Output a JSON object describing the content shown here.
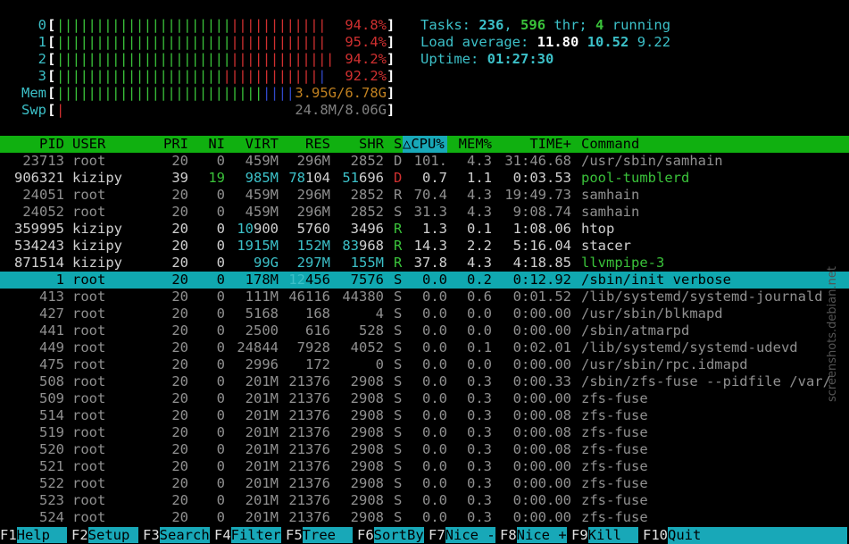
{
  "colors": {
    "green": "#3ac23a",
    "red": "#d03030",
    "blue": "#3048c8",
    "orange": "#c08020",
    "gray": "#808080",
    "cyan": "#3cc0c8",
    "teal": "#18a8b8",
    "white": "#ffffff",
    "dim": "#909090"
  },
  "cpus": [
    {
      "label": "0",
      "green": "||||||||||||||||||||||",
      "red": "||||||||||||",
      "blue": "",
      "pct": "94.8%"
    },
    {
      "label": "1",
      "green": "||||||||||||||||||||||",
      "red": "||||||||||||",
      "blue": "",
      "pct": "95.4%"
    },
    {
      "label": "2",
      "green": "||||||||||||||||||||||",
      "red": "|||||||||||||",
      "blue": "",
      "pct": "94.2%"
    },
    {
      "label": "3",
      "green": "|||||||||||||||||||||",
      "red": "||||||||||||",
      "blue": "|",
      "pct": "92.2%"
    }
  ],
  "mem": {
    "label": "Mem",
    "green": "||||||||||||||||||||||||||",
    "blue": "||||",
    "value": "3.95G/6.78G"
  },
  "swp": {
    "label": "Swp",
    "red": "|",
    "value": "24.8M/8.06G"
  },
  "summary": {
    "tasks_label": "Tasks:",
    "tasks": "236",
    "sep": ",",
    "threads": "596",
    "thr_label": "thr;",
    "running": "4",
    "running_label": "running",
    "load_label": "Load average:",
    "load1": "11.80",
    "load5": "10.52",
    "load15": "9.22",
    "uptime_label": "Uptime:",
    "uptime": "01:27:30"
  },
  "header": {
    "pid": "PID",
    "user": "USER",
    "pri": "PRI",
    "ni": "NI",
    "virt": "VIRT",
    "res": "RES",
    "shr": "SHR",
    "s": "S",
    "cpu": "△CPU%",
    "mem": "MEM%",
    "time": "TIME+",
    "cmd": "Command"
  },
  "rows": [
    {
      "pid": "23713",
      "user": "root",
      "pri": "20",
      "ni": "0",
      "virt": "459M",
      "res": "296M",
      "shr": "2852",
      "s": "D",
      "cpu": "101.",
      "mem": "4.3",
      "time": "31:46.68",
      "cmd": "/usr/sbin/samhain",
      "thread": true
    },
    {
      "pid": "906321",
      "user": "kizipy",
      "pri": "39",
      "ni": "19",
      "virt": "985M",
      "res": "78104",
      "shr": "51696",
      "s": "D",
      "cpu": "0.7",
      "mem": "1.1",
      "time": "0:03.53",
      "cmd": "pool-tumblerd",
      "thread": false
    },
    {
      "pid": "24051",
      "user": "root",
      "pri": "20",
      "ni": "0",
      "virt": "459M",
      "res": "296M",
      "shr": "2852",
      "s": "R",
      "cpu": "70.4",
      "mem": "4.3",
      "time": "19:49.73",
      "cmd": "samhain",
      "thread": true
    },
    {
      "pid": "24052",
      "user": "root",
      "pri": "20",
      "ni": "0",
      "virt": "459M",
      "res": "296M",
      "shr": "2852",
      "s": "S",
      "cpu": "31.3",
      "mem": "4.3",
      "time": "9:08.74",
      "cmd": "samhain",
      "thread": true
    },
    {
      "pid": "359995",
      "user": "kizipy",
      "pri": "20",
      "ni": "0",
      "virt": "10900",
      "res": "5760",
      "shr": "3496",
      "s": "R",
      "cpu": "1.3",
      "mem": "0.1",
      "time": "1:08.06",
      "cmd": "htop",
      "thread": false
    },
    {
      "pid": "534243",
      "user": "kizipy",
      "pri": "20",
      "ni": "0",
      "virt": "1915M",
      "res": "152M",
      "shr": "83968",
      "s": "R",
      "cpu": "14.3",
      "mem": "2.2",
      "time": "5:16.04",
      "cmd": "stacer",
      "thread": false
    },
    {
      "pid": "871514",
      "user": "kizipy",
      "pri": "20",
      "ni": "0",
      "virt": "99G",
      "res": "297M",
      "shr": "155M",
      "s": "R",
      "cpu": "37.8",
      "mem": "4.3",
      "time": "4:18.85",
      "cmd": "llvmpipe-3",
      "thread": false
    },
    {
      "pid": "1",
      "user": "root",
      "pri": "20",
      "ni": "0",
      "virt": "178M",
      "res": "12456",
      "shr": "7576",
      "s": "S",
      "cpu": "0.0",
      "mem": "0.2",
      "time": "0:12.92",
      "cmd": "/sbin/init verbose",
      "thread": false,
      "selected": true
    },
    {
      "pid": "413",
      "user": "root",
      "pri": "20",
      "ni": "0",
      "virt": "111M",
      "res": "46116",
      "shr": "44380",
      "s": "S",
      "cpu": "0.0",
      "mem": "0.6",
      "time": "0:01.52",
      "cmd": "/lib/systemd/systemd-journald",
      "thread": true
    },
    {
      "pid": "427",
      "user": "root",
      "pri": "20",
      "ni": "0",
      "virt": "5168",
      "res": "168",
      "shr": "4",
      "s": "S",
      "cpu": "0.0",
      "mem": "0.0",
      "time": "0:00.00",
      "cmd": "/usr/sbin/blkmapd",
      "thread": true
    },
    {
      "pid": "441",
      "user": "root",
      "pri": "20",
      "ni": "0",
      "virt": "2500",
      "res": "616",
      "shr": "528",
      "s": "S",
      "cpu": "0.0",
      "mem": "0.0",
      "time": "0:00.00",
      "cmd": "/sbin/atmarpd",
      "thread": true
    },
    {
      "pid": "449",
      "user": "root",
      "pri": "20",
      "ni": "0",
      "virt": "24844",
      "res": "7928",
      "shr": "4052",
      "s": "S",
      "cpu": "0.0",
      "mem": "0.1",
      "time": "0:02.01",
      "cmd": "/lib/systemd/systemd-udevd",
      "thread": true
    },
    {
      "pid": "475",
      "user": "root",
      "pri": "20",
      "ni": "0",
      "virt": "2996",
      "res": "172",
      "shr": "0",
      "s": "S",
      "cpu": "0.0",
      "mem": "0.0",
      "time": "0:00.00",
      "cmd": "/usr/sbin/rpc.idmapd",
      "thread": true
    },
    {
      "pid": "508",
      "user": "root",
      "pri": "20",
      "ni": "0",
      "virt": "201M",
      "res": "21376",
      "shr": "2908",
      "s": "S",
      "cpu": "0.0",
      "mem": "0.3",
      "time": "0:00.33",
      "cmd": "/sbin/zfs-fuse --pidfile /var/",
      "thread": true
    },
    {
      "pid": "509",
      "user": "root",
      "pri": "20",
      "ni": "0",
      "virt": "201M",
      "res": "21376",
      "shr": "2908",
      "s": "S",
      "cpu": "0.0",
      "mem": "0.3",
      "time": "0:00.00",
      "cmd": "zfs-fuse",
      "thread": true
    },
    {
      "pid": "514",
      "user": "root",
      "pri": "20",
      "ni": "0",
      "virt": "201M",
      "res": "21376",
      "shr": "2908",
      "s": "S",
      "cpu": "0.0",
      "mem": "0.3",
      "time": "0:00.08",
      "cmd": "zfs-fuse",
      "thread": true
    },
    {
      "pid": "519",
      "user": "root",
      "pri": "20",
      "ni": "0",
      "virt": "201M",
      "res": "21376",
      "shr": "2908",
      "s": "S",
      "cpu": "0.0",
      "mem": "0.3",
      "time": "0:00.08",
      "cmd": "zfs-fuse",
      "thread": true
    },
    {
      "pid": "520",
      "user": "root",
      "pri": "20",
      "ni": "0",
      "virt": "201M",
      "res": "21376",
      "shr": "2908",
      "s": "S",
      "cpu": "0.0",
      "mem": "0.3",
      "time": "0:00.08",
      "cmd": "zfs-fuse",
      "thread": true
    },
    {
      "pid": "521",
      "user": "root",
      "pri": "20",
      "ni": "0",
      "virt": "201M",
      "res": "21376",
      "shr": "2908",
      "s": "S",
      "cpu": "0.0",
      "mem": "0.3",
      "time": "0:00.00",
      "cmd": "zfs-fuse",
      "thread": true
    },
    {
      "pid": "522",
      "user": "root",
      "pri": "20",
      "ni": "0",
      "virt": "201M",
      "res": "21376",
      "shr": "2908",
      "s": "S",
      "cpu": "0.0",
      "mem": "0.3",
      "time": "0:00.00",
      "cmd": "zfs-fuse",
      "thread": true
    },
    {
      "pid": "523",
      "user": "root",
      "pri": "20",
      "ni": "0",
      "virt": "201M",
      "res": "21376",
      "shr": "2908",
      "s": "S",
      "cpu": "0.0",
      "mem": "0.3",
      "time": "0:00.00",
      "cmd": "zfs-fuse",
      "thread": true
    },
    {
      "pid": "524",
      "user": "root",
      "pri": "20",
      "ni": "0",
      "virt": "201M",
      "res": "21376",
      "shr": "2908",
      "s": "S",
      "cpu": "0.0",
      "mem": "0.3",
      "time": "0:00.00",
      "cmd": "zfs-fuse",
      "thread": true
    }
  ],
  "fkeys": [
    {
      "key": "F1",
      "label": "Help  "
    },
    {
      "key": "F2",
      "label": "Setup "
    },
    {
      "key": "F3",
      "label": "Search"
    },
    {
      "key": "F4",
      "label": "Filter"
    },
    {
      "key": "F5",
      "label": "Tree  "
    },
    {
      "key": "F6",
      "label": "SortBy"
    },
    {
      "key": "F7",
      "label": "Nice -"
    },
    {
      "key": "F8",
      "label": "Nice +"
    },
    {
      "key": "F9",
      "label": "Kill  "
    },
    {
      "key": "F10",
      "label": "Quit"
    }
  ],
  "watermark": "screenshots.debian.net"
}
